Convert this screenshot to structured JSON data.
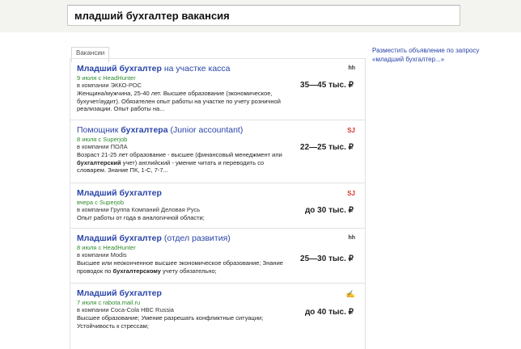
{
  "search": {
    "query": "младший бухгалтер вакансия"
  },
  "tab": {
    "label": "Вакансии"
  },
  "ad": {
    "line1": "Разместить объявление по запросу",
    "line2": "«младший бухгалтер...»"
  },
  "jobs": [
    {
      "title_bold": "Младший бухгалтер",
      "title_rest": " на участке касса",
      "date": "9 июля с HeadHunter",
      "company": "в компании ЭККО-РОС",
      "desc": "Женщина/мужчина, 25-40 лет. Высшее образование (экономическое, бухучет/аудит). Обязателен опыт работы на участке по учету розничной реализации. Опыт работы на...",
      "salary": "35—45 тыс. ₽",
      "source_icon": "hh"
    },
    {
      "title_pre": "Помощник ",
      "title_bold": "бухгалтера",
      "title_rest": " (Junior accountant)",
      "date": "8 июля с Superjob",
      "company": "в компании ПОЛА",
      "desc_1": "Возраст 21-25 лет образование - высшее (финансовый менеджмент или ",
      "desc_bold": "бухгалтерский",
      "desc_2": " учет) английский - умение читать и переводить со словарем. Знание ПК, 1-С, 7-7...",
      "salary": "22—25 тыс. ₽",
      "source_icon": "SJ"
    },
    {
      "title_bold": "Младший бухгалтер",
      "date": "вчера с Superjob",
      "company": "в компании Группа Компаний Деловая Русь",
      "desc": "Опыт работы от года в аналогичной области;",
      "salary": "до 30 тыс. ₽",
      "source_icon": "SJ"
    },
    {
      "title_bold": "Младший бухгалтер",
      "title_rest": " (отдел развития)",
      "date": "8 июля с HeadHunter",
      "company": "в компании Modis",
      "desc_1": "Высшее или неоконченное высшее экономическое образование; Знание проводок по ",
      "desc_bold": "бухгалтерскому",
      "desc_2": " учету обязательно;",
      "salary": "25—30 тыс. ₽",
      "source_icon": "hh"
    },
    {
      "title_bold": "Младший бухгалтер",
      "date": "7 июля с rabota.mail.ru",
      "company": "в компании Coca-Cola HBC Russia",
      "desc": "Высшее образование; Умение разрешать конфликтные ситуации; Устойчивость к стрессам;",
      "salary": "до 40 тыс. ₽",
      "source_icon": "mail"
    }
  ]
}
